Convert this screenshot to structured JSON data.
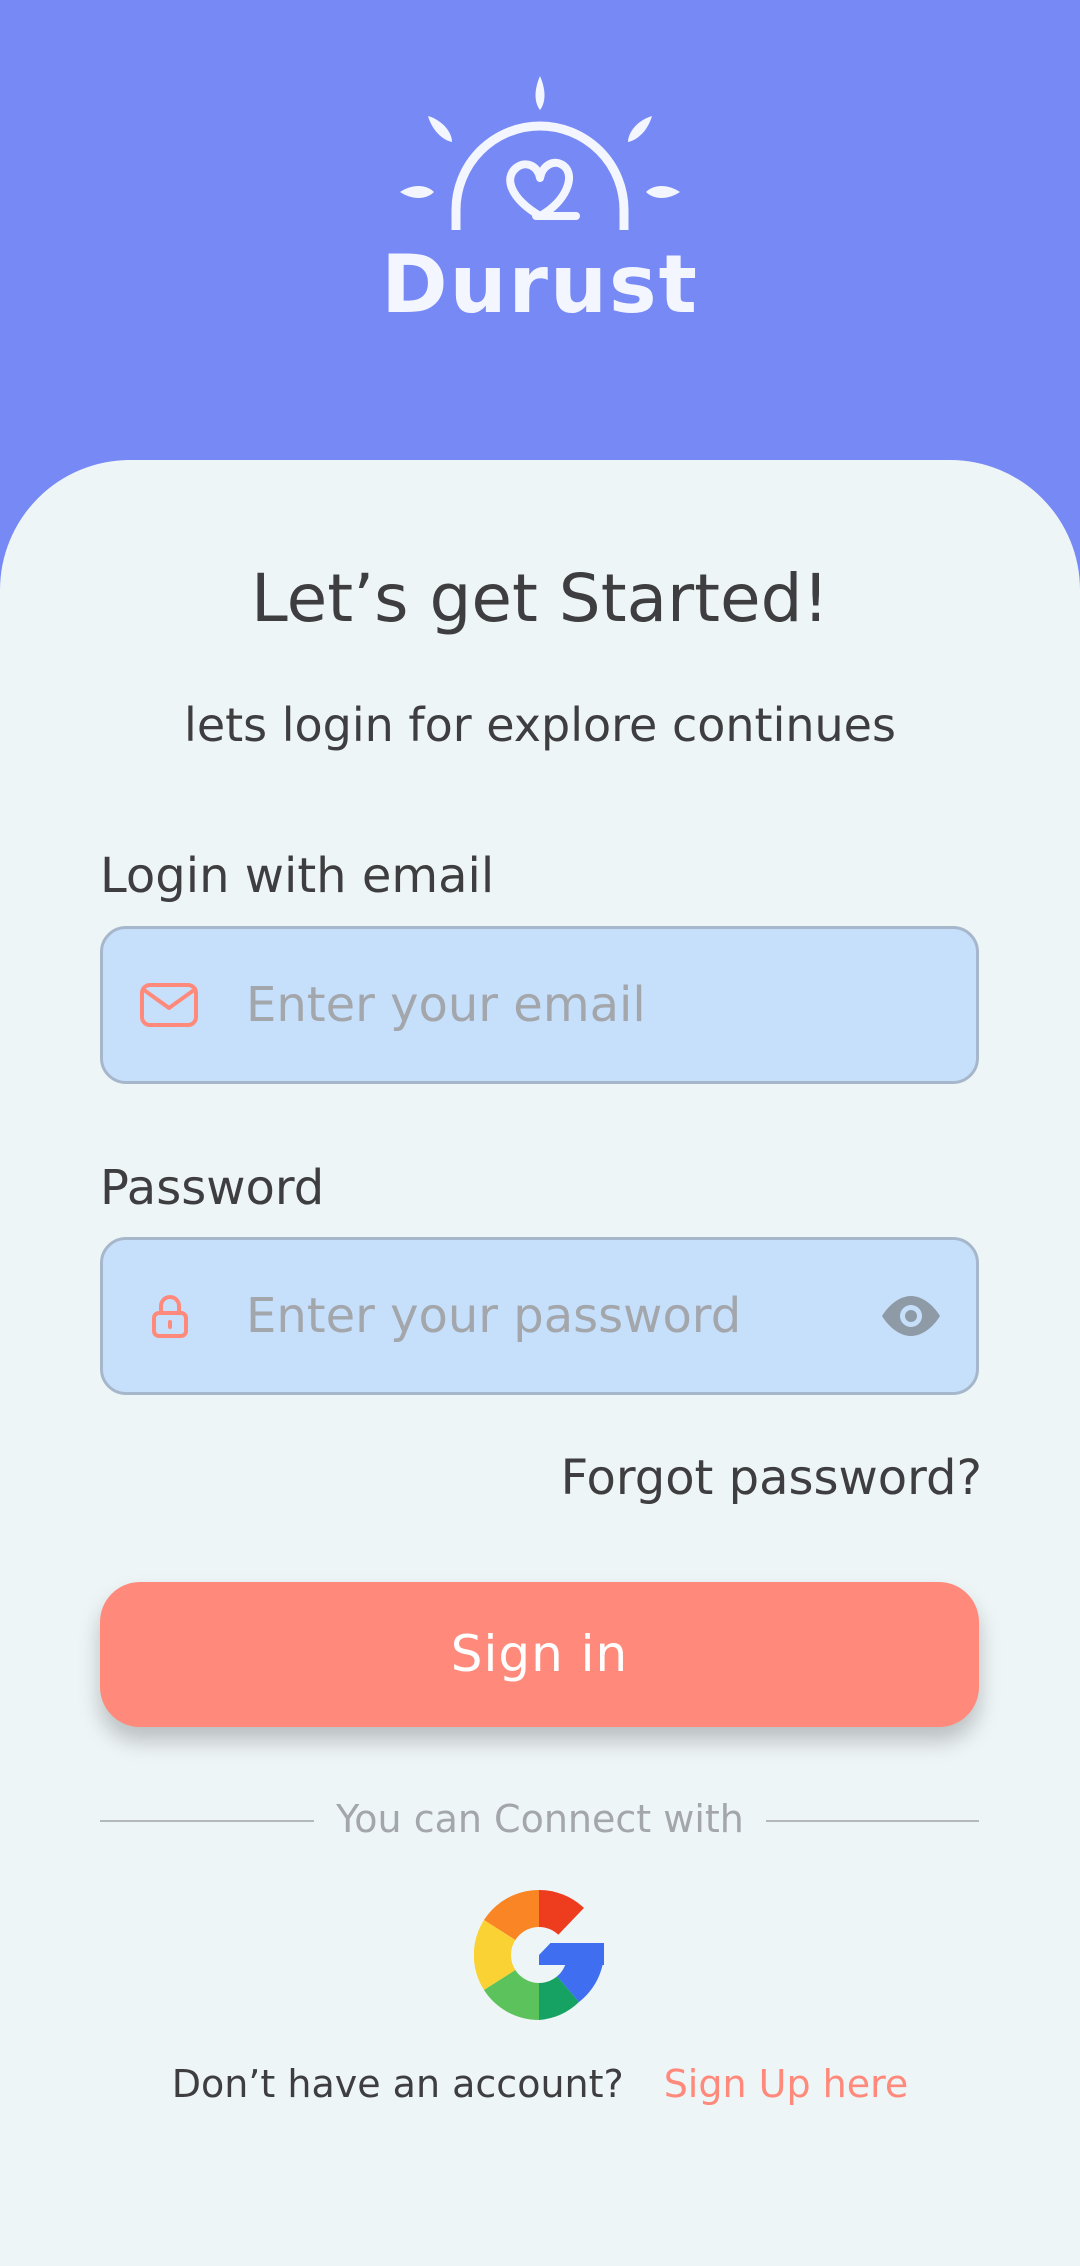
{
  "brand": {
    "name": "Durust"
  },
  "colors": {
    "header_bg": "#7789f5",
    "card_bg": "#eef5f7",
    "field_bg": "#c6e0fb",
    "accent": "#ff8a7b",
    "text": "#3e3e40",
    "placeholder": "#a3a6ab"
  },
  "welcome": {
    "title": "Let’s get Started!",
    "subtitle": "lets login for explore continues"
  },
  "email": {
    "label": "Login with email",
    "placeholder": "Enter your email",
    "icon": "mail-icon"
  },
  "password": {
    "label": "Password",
    "placeholder": "Enter your password",
    "icon": "lock-icon",
    "toggle_icon": "eye-icon"
  },
  "forgot_password": "Forgot password?",
  "signin_button": "Sign in",
  "social": {
    "connect_text": "You can Connect with",
    "google_icon": "google-icon"
  },
  "footer": {
    "question": "Don’t have an account?",
    "signup_link": "Sign Up here"
  }
}
